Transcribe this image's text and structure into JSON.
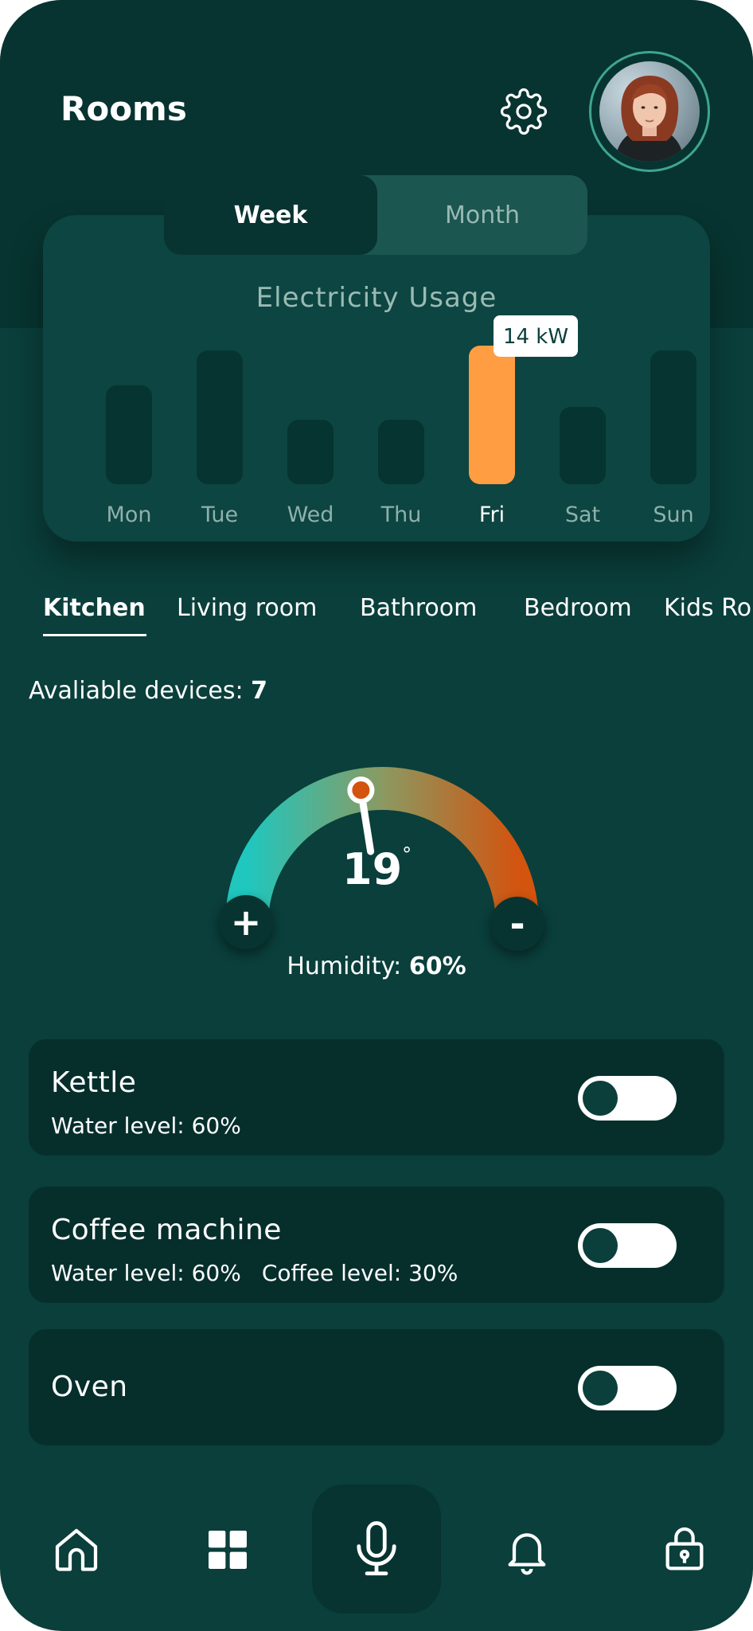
{
  "header": {
    "title": "Rooms",
    "settings_icon": "gear-icon",
    "avatar": "user-avatar"
  },
  "usage": {
    "period_tabs": [
      "Week",
      "Month"
    ],
    "selected_period": "Week"
  },
  "chart_data": {
    "type": "bar",
    "title": "Electricity Usage",
    "categories": [
      "Mon",
      "Tue",
      "Wed",
      "Thu",
      "Fri",
      "Sat",
      "Sun"
    ],
    "values": [
      10,
      13.5,
      6.5,
      6.5,
      14,
      7.8,
      13.5
    ],
    "unit": "kW",
    "highlighted": "Fri",
    "highlight_label": "14 kW",
    "ylim": [
      0,
      14
    ],
    "colors": {
      "bar": "#063430",
      "highlight": "#ff9d42"
    }
  },
  "rooms": {
    "tabs": [
      "Kitchen",
      "Living room",
      "Bathroom",
      "Bedroom",
      "Kids Ro"
    ],
    "active": "Kitchen"
  },
  "devices_available": {
    "label": "Avaliable devices: ",
    "count": "7"
  },
  "climate": {
    "temperature": "19",
    "degree": "°",
    "humidity_label": "Humidity: ",
    "humidity_value": "60%",
    "plus": "+",
    "minus": "-",
    "dial_fraction": 0.45,
    "gradient": [
      "#1fc7bf",
      "#d2540f"
    ]
  },
  "devices": [
    {
      "name": "Kettle",
      "meta": [
        "Water level: 60%"
      ],
      "on": false
    },
    {
      "name": "Coffee machine",
      "meta": [
        "Water level: 60%",
        "Coffee level: 30%"
      ],
      "on": false
    },
    {
      "name": "Oven",
      "meta": [],
      "on": false
    }
  ],
  "nav": {
    "items": [
      "home-icon",
      "grid-icon",
      "microphone-icon",
      "bell-icon",
      "lock-icon"
    ],
    "active": "microphone-icon"
  }
}
